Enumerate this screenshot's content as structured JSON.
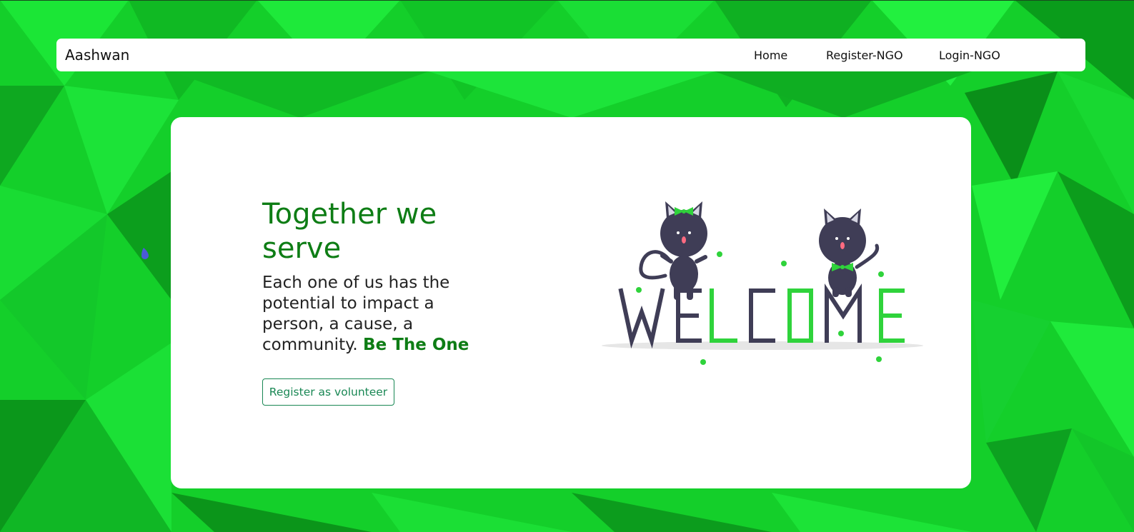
{
  "colors": {
    "background_green": "#15d62b",
    "headline_green": "#0e7d15",
    "button_outline": "#198754",
    "illustration_dark": "#3f3d56",
    "illustration_accent": "#2fd33b"
  },
  "navbar": {
    "brand": "Aashwan",
    "links": [
      {
        "label": "Home"
      },
      {
        "label": "Register-NGO"
      },
      {
        "label": "Login-NGO"
      }
    ]
  },
  "hero": {
    "headline": "Together we serve",
    "lead_text": "Each one of us has the potential to impact a person, a cause, a community.",
    "lead_emphasis": "Be The One",
    "button_label": "Register as volunteer"
  },
  "illustration": {
    "letters": [
      "W",
      "E",
      "L",
      "C",
      "O",
      "M",
      "E"
    ],
    "icons": [
      "cat-left-icon",
      "cat-right-icon"
    ]
  }
}
